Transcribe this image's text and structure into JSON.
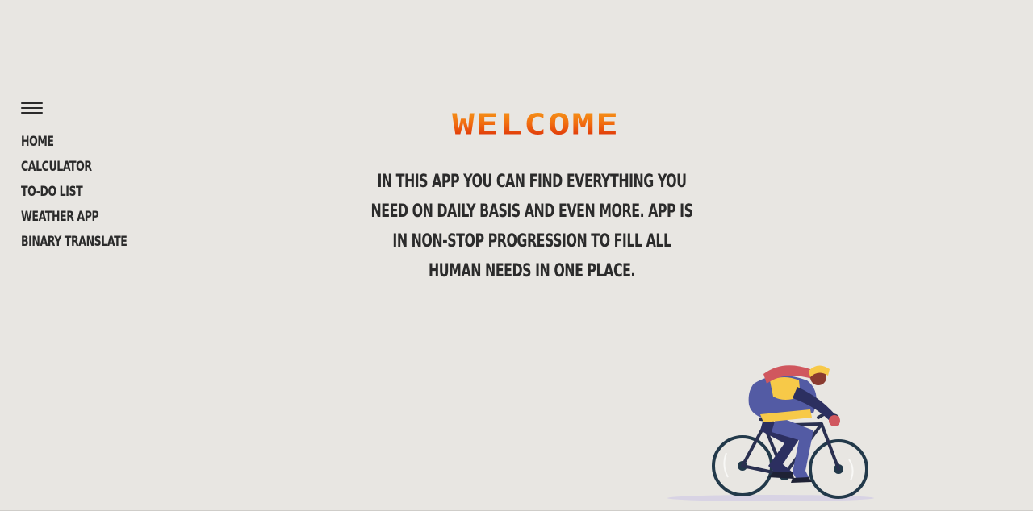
{
  "sidebar": {
    "menu_icon": "hamburger-icon",
    "items": [
      {
        "label": "HOME"
      },
      {
        "label": "CALCULATOR"
      },
      {
        "label": "TO-DO LIST"
      },
      {
        "label": "WEATHER APP"
      },
      {
        "label": "BINARY TRANSLATE"
      }
    ]
  },
  "main": {
    "title": "WELCOME",
    "description": "IN THIS APP YOU CAN FIND EVERYTHING YOU NEED ON DAILY BASIS AND EVEN MORE. APP IS IN NON-STOP PROGRESSION TO FILL ALL HUMAN NEEDS IN ONE PLACE.",
    "illustration": "cyclist-illustration"
  },
  "colors": {
    "background": "#e8e6e2",
    "text": "#2b2b2b",
    "title_gradient_top": "#f7a41c",
    "title_gradient_bottom": "#d81e06"
  }
}
